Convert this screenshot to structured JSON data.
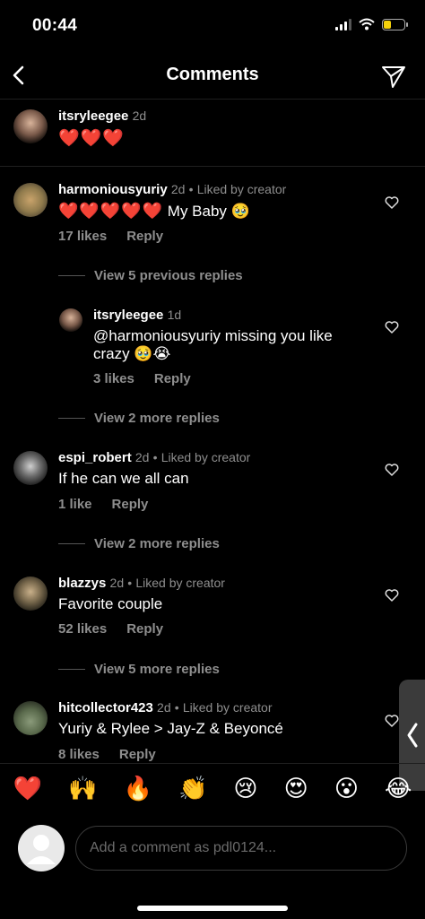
{
  "status": {
    "time": "00:44"
  },
  "header": {
    "title": "Comments"
  },
  "caption": {
    "username": "itsryleegee",
    "time": "2d",
    "text": "❤️❤️❤️"
  },
  "comments": [
    {
      "username": "harmoniousyuriy",
      "time": "2d",
      "liked_by": "Liked by creator",
      "text_emoji": "❤️❤️❤️❤️❤️",
      "text": "My Baby 🥹",
      "likes": "17 likes",
      "reply": "Reply",
      "view_more": "View 5 previous replies"
    },
    {
      "username": "itsryleegee",
      "time": "1d",
      "liked_by": "",
      "text": "@harmoniousyuriy missing you like crazy 🥹😭",
      "likes": "3 likes",
      "reply": "Reply",
      "view_more": "View 2 more replies"
    },
    {
      "username": "espi_robert",
      "time": "2d",
      "liked_by": "Liked by creator",
      "text": "If he can we all can",
      "likes": "1 like",
      "reply": "Reply",
      "view_more": "View 2 more replies"
    },
    {
      "username": "blazzys",
      "time": "2d",
      "liked_by": "Liked by creator",
      "text": "Favorite couple",
      "likes": "52 likes",
      "reply": "Reply",
      "view_more": "View 5 more replies"
    },
    {
      "username": "hitcollector423",
      "time": "2d",
      "liked_by": "Liked by creator",
      "text": "Yuriy & Rylee > Jay-Z & Beyoncé",
      "likes": "8 likes",
      "reply": "Reply"
    }
  ],
  "emoji_bar": [
    "❤️",
    "🙌",
    "🔥",
    "👏",
    "😢",
    "😍",
    "😮",
    "😂"
  ],
  "input": {
    "placeholder": "Add a comment as pdl0124..."
  },
  "colors": {
    "background": "#000000",
    "secondary_text": "#8e8e8e",
    "heart": "#e0242f",
    "battery": "#f5d20a"
  }
}
